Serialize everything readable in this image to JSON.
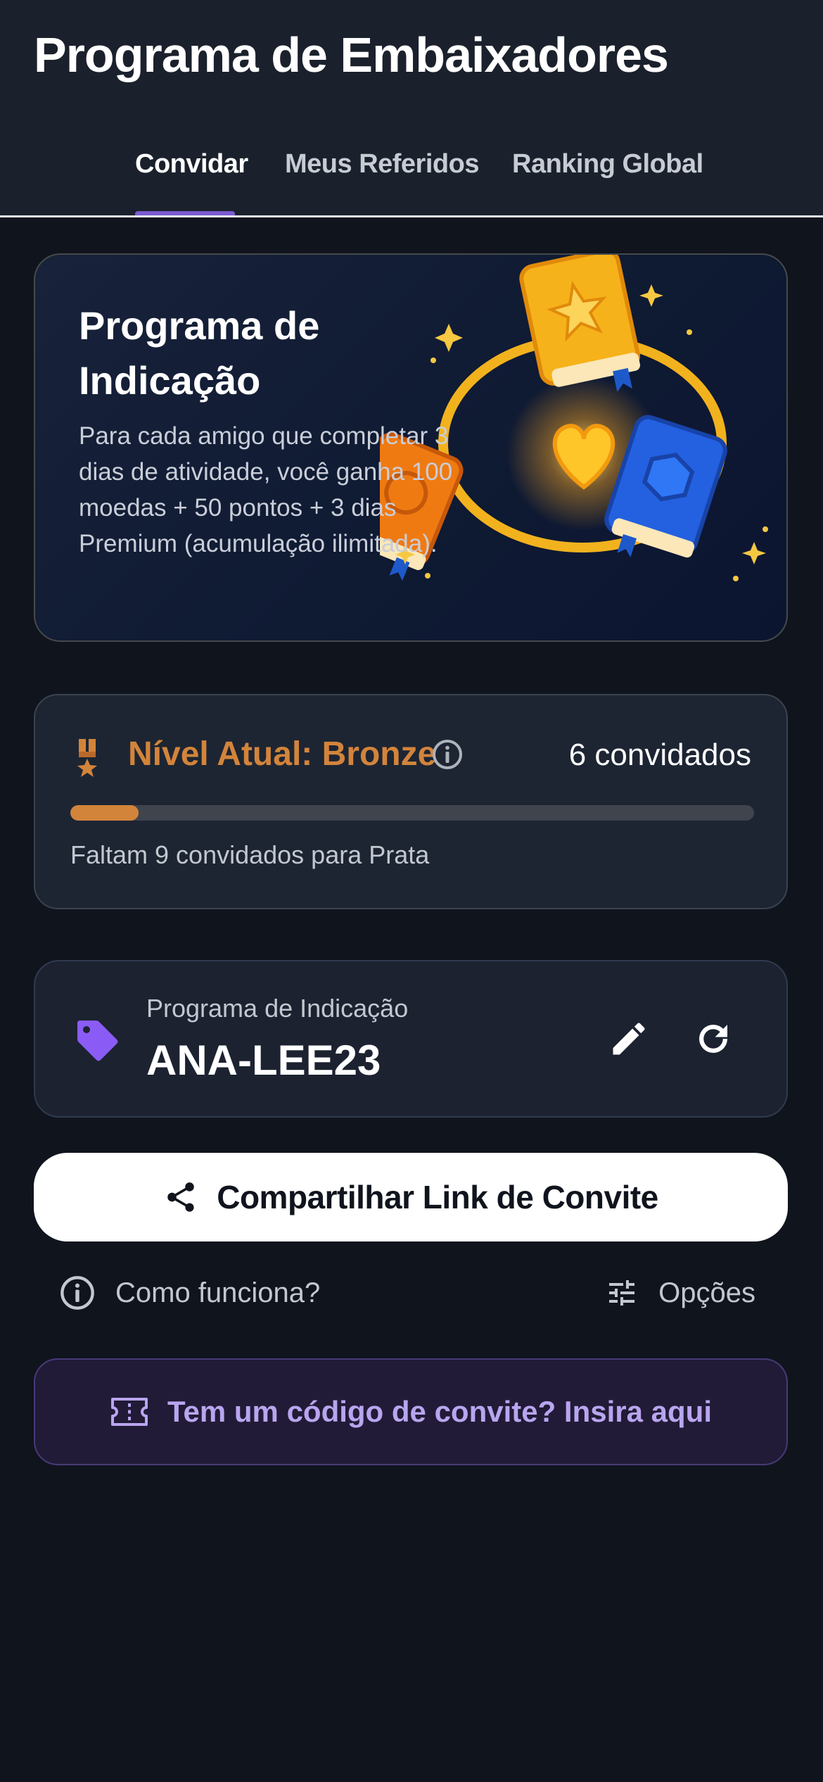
{
  "app": {
    "title": "Programa de Embaixadores"
  },
  "tabs": [
    {
      "label": "Convidar",
      "active": true
    },
    {
      "label": "Meus Referidos",
      "active": false
    },
    {
      "label": "Ranking Global",
      "active": false
    }
  ],
  "hero": {
    "title_line1": "Programa de",
    "title_line2": "Indicação",
    "description": "Para cada amigo que completar 3 dias de atividade, você ganha 100 moedas + 50 pontos + 3 dias Premium (acumulação ilimitada)."
  },
  "level": {
    "icon": "medal-icon",
    "title": "Nível Atual: Bronze",
    "info_icon": "info-icon",
    "count_text": "6 convidados",
    "progress_fraction": 0.1,
    "next_text": "Faltam 9 convidados para Prata",
    "accent_color": "#d3843b"
  },
  "code": {
    "icon": "tag-icon",
    "label": "Programa de Indicação",
    "value": "ANA-LEE23",
    "edit_icon": "pencil-icon",
    "refresh_icon": "refresh-icon"
  },
  "share": {
    "icon": "share-icon",
    "label": "Compartilhar Link de Convite"
  },
  "links": {
    "how_icon": "info-icon",
    "how_label": "Como funciona?",
    "options_icon": "sliders-icon",
    "options_label": "Opções"
  },
  "invite_code": {
    "icon": "ticket-icon",
    "label": "Tem um código de convite? Insira aqui",
    "color": "#b9a5ef"
  },
  "colors": {
    "background": "#10141d",
    "header": "#1b212c",
    "tab_indicator": "#7a5bd0"
  }
}
